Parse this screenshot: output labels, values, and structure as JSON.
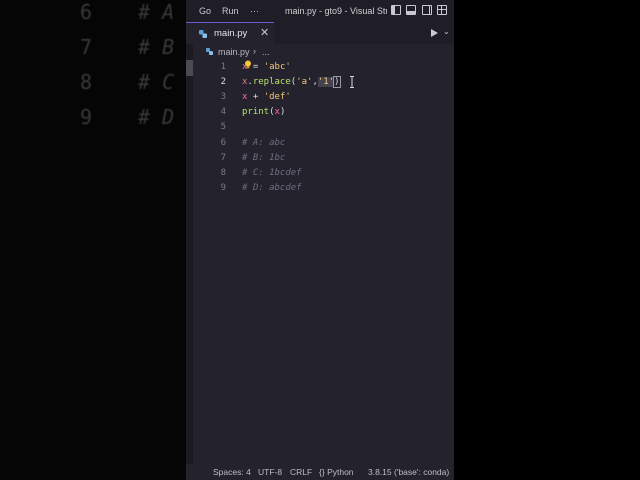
{
  "background_code": {
    "lines": [
      {
        "num": "6",
        "text": "# A"
      },
      {
        "num": "7",
        "text": "# B"
      },
      {
        "num": "8",
        "text": "# C"
      },
      {
        "num": "9",
        "text": "# D"
      }
    ]
  },
  "titlebar": {
    "menu": [
      "Go",
      "Run"
    ],
    "more": "···",
    "title": "main.py - gto9 - Visual Stu..."
  },
  "tab": {
    "label": "main.py",
    "close": "✕"
  },
  "breadcrumb": {
    "file": "main.py",
    "separator": "›",
    "rest": "..."
  },
  "editor": {
    "line_numbers": [
      "1",
      "2",
      "3",
      "4",
      "5",
      "6",
      "7",
      "8",
      "9"
    ],
    "lines": {
      "l1_var": "x",
      "l1_rest": " = ",
      "l1_str": "'abc'",
      "l2_var": "x",
      "l2_dot": ".",
      "l2_fn": "replace",
      "l2_open": "(",
      "l2_str1": "'a'",
      "l2_comma": ",",
      "l2_str2": "'1'",
      "l2_close": ")",
      "l3_var": "x",
      "l3_op": " + ",
      "l3_str": "'def'",
      "l4_fn": "print",
      "l4_open": "(",
      "l4_var": "x",
      "l4_close": ")",
      "l6": "# A: abc",
      "l7": "# B: 1bc",
      "l8": "# C: 1bcdef",
      "l9": "# D: abcdef"
    }
  },
  "statusbar": {
    "spaces": "Spaces: 4",
    "encoding": "UTF-8",
    "eol": "CRLF",
    "language": "Python",
    "interpreter": "3.8.15 ('base': conda)"
  },
  "colors": {
    "accent": "#6d5cc6",
    "editor_bg": "#24222c",
    "variable": "#f3758f",
    "function": "#b7e36a",
    "string": "#f2c97a",
    "comment": "#6f6e7c"
  }
}
